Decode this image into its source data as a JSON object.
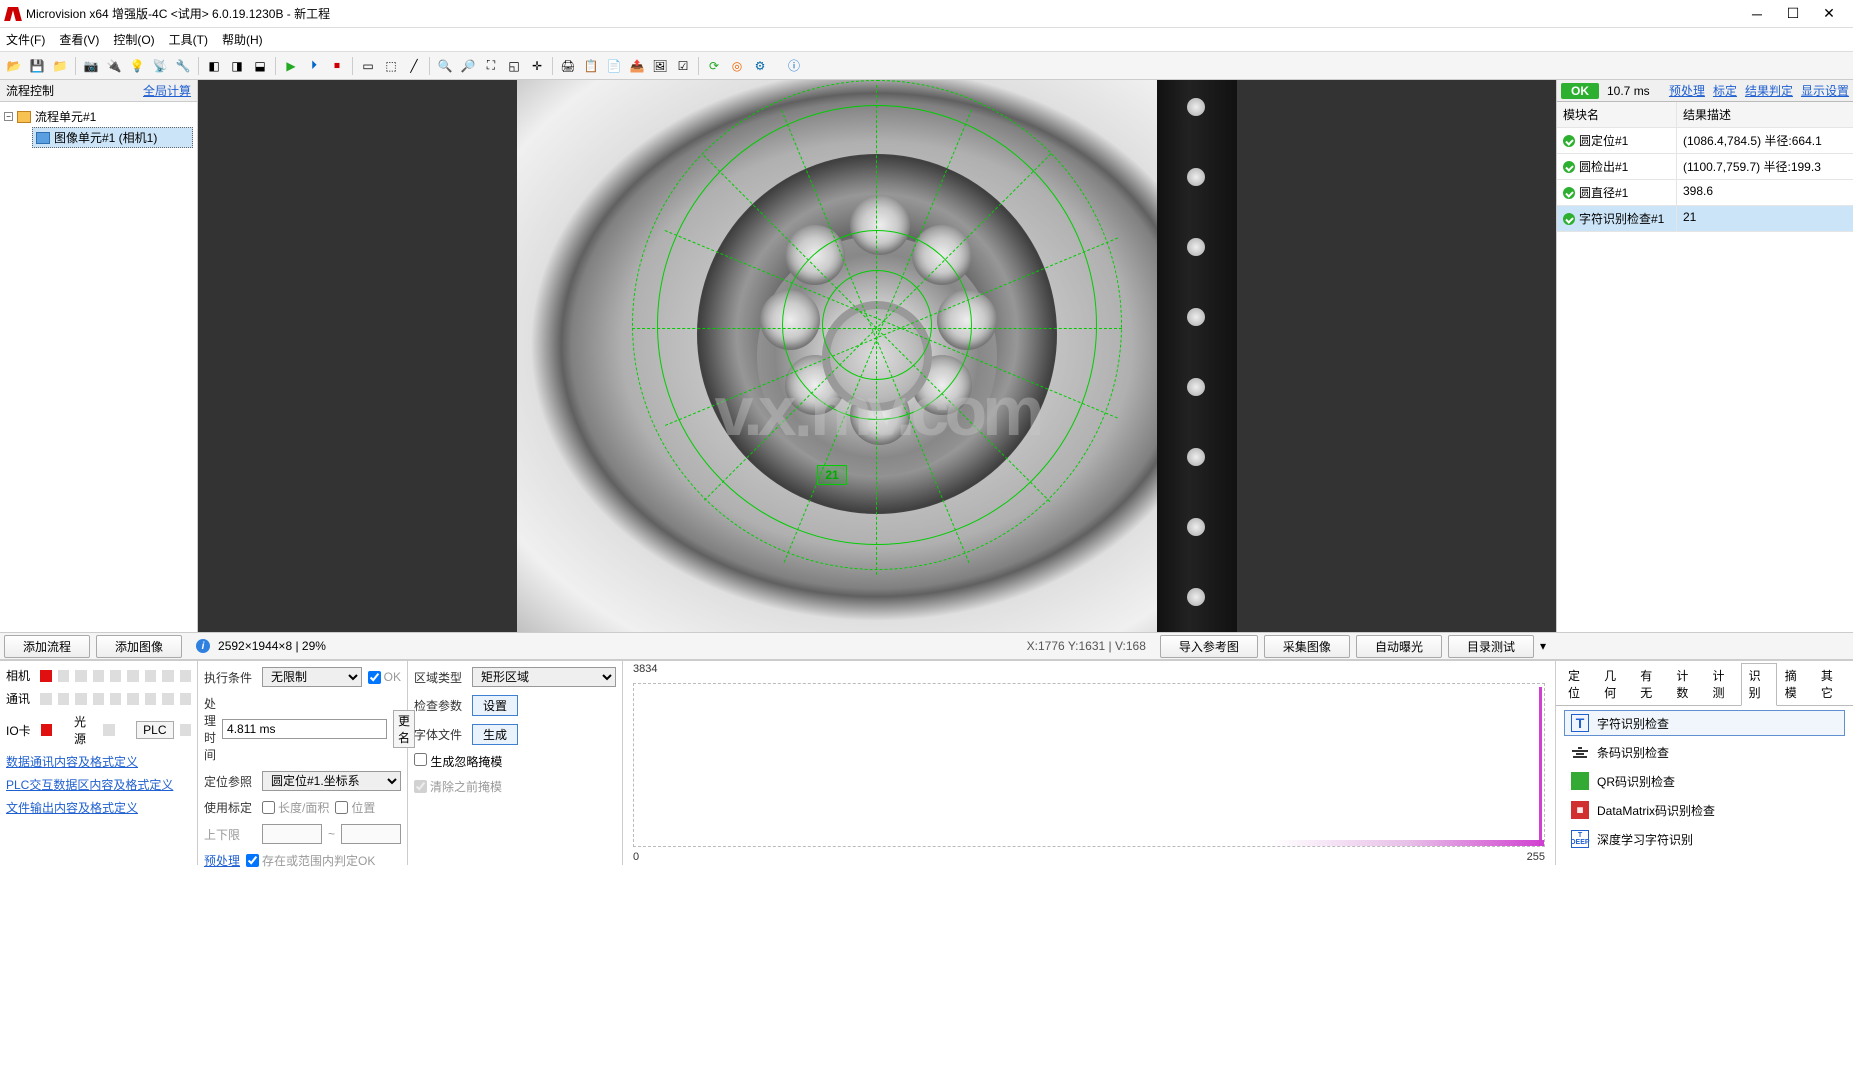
{
  "app_title": "Microvision x64 增强版-4C <试用> 6.0.19.1230B - 新工程",
  "menu": {
    "file": "文件(F)",
    "view": "查看(V)",
    "control": "控制(O)",
    "tools": "工具(T)",
    "help": "帮助(H)"
  },
  "left": {
    "title": "流程控制",
    "global_calc": "全局计算",
    "tree_root": "流程单元#1",
    "tree_child": "图像单元#1 (相机1)",
    "add_flow": "添加流程",
    "add_image": "添加图像"
  },
  "viewport": {
    "info": "2592×1944×8 | 29%",
    "coord": "X:1776 Y:1631 | V:168",
    "import_ref": "导入参考图",
    "capture": "采集图像",
    "auto_exposure": "自动曝光",
    "dir_test": "目录测试",
    "overlay_text": "21"
  },
  "results": {
    "status": "OK",
    "time": "10.7 ms",
    "links": {
      "preprocess": "预处理",
      "calibrate": "标定",
      "judge": "结果判定",
      "display": "显示设置"
    },
    "headers": {
      "module": "模块名",
      "desc": "结果描述"
    },
    "rows": [
      {
        "name": "圆定位#1",
        "desc": "(1086.4,784.5) 半径:664.1"
      },
      {
        "name": "圆检出#1",
        "desc": "(1100.7,759.7) 半径:199.3"
      },
      {
        "name": "圆直径#1",
        "desc": "398.6"
      },
      {
        "name": "字符识别检查#1",
        "desc": "21"
      }
    ]
  },
  "lower_left": {
    "camera": "相机",
    "comm": "通讯",
    "io": "IO卡",
    "light": "光源",
    "plc": "PLC",
    "link1": "数据通讯内容及格式定义",
    "link2": "PLC交互数据区内容及格式定义",
    "link3": "文件输出内容及格式定义"
  },
  "params": {
    "exec_cond": "执行条件",
    "exec_val": "无限制",
    "ok": "OK",
    "proc_time": "处理时间",
    "proc_val": "4.811 ms",
    "rename": "更名",
    "loc_ref": "定位参照",
    "loc_val": "圆定位#1.坐标系",
    "use_calib": "使用标定",
    "len_area": "长度/面积",
    "position": "位置",
    "limits": "上下限",
    "preprocess": "预处理",
    "save_ok": "存在或范围内判定OK"
  },
  "region": {
    "type_label": "区域类型",
    "type_val": "矩形区域",
    "check_label": "检查参数",
    "settings_btn": "设置",
    "font_label": "字体文件",
    "gen_btn": "生成",
    "gen_template": "生成忽略掩模",
    "clear_template": "清除之前掩模"
  },
  "histogram": {
    "max": "3834",
    "min": "0",
    "right": "255"
  },
  "tabs": {
    "loc": "定位",
    "geom": "几何",
    "presence": "有无",
    "count": "计数",
    "measure": "计测",
    "recog": "识别",
    "template": "摘模",
    "other": "其它"
  },
  "tools": {
    "char": "字符识别检查",
    "barcode": "条码识别检查",
    "qr": "QR码识别检查",
    "dm": "DataMatrix码识别检查",
    "deep": "深度学习字符识别"
  }
}
